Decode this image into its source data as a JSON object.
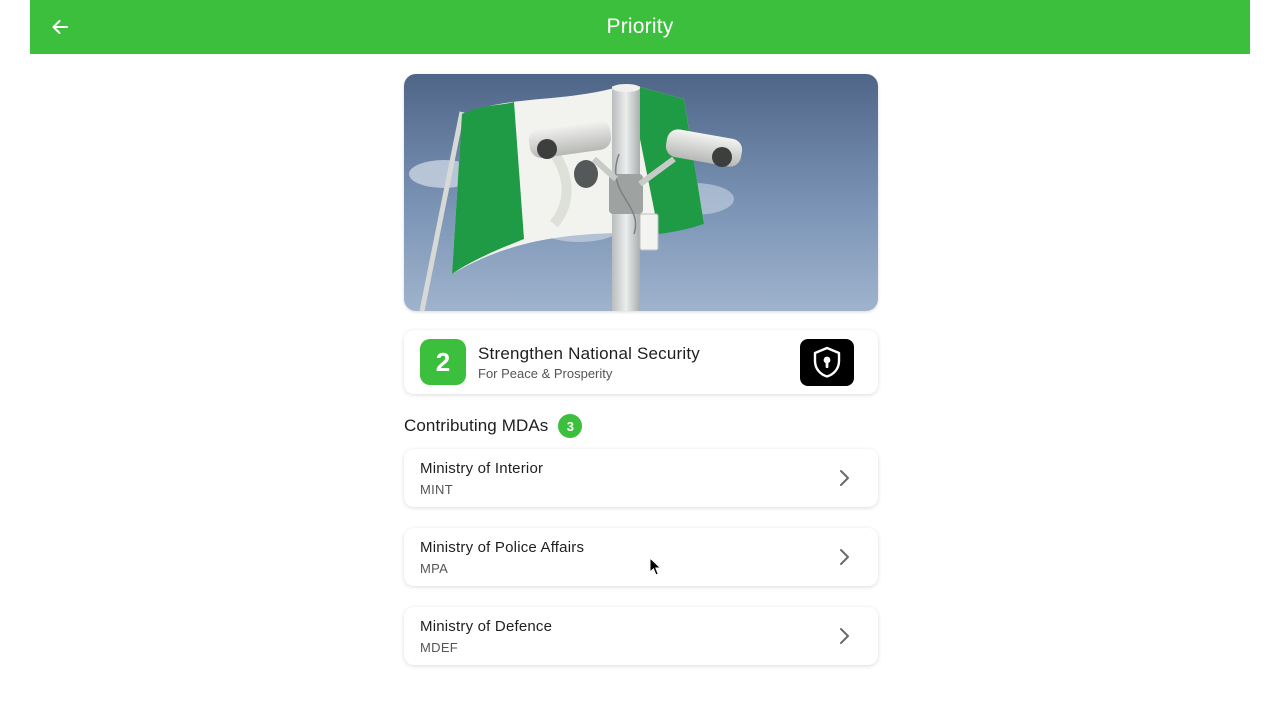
{
  "app_bar": {
    "title": "Priority",
    "back_icon": "arrow-left-icon",
    "color": "#3cbf3c"
  },
  "hero": {
    "image": "security-cameras-nigeria-flag-photo"
  },
  "priority": {
    "number": "2",
    "title": "Strengthen National Security",
    "subtitle": "For Peace & Prosperity",
    "icon": "shield-lock-icon"
  },
  "section": {
    "title": "Contributing MDAs",
    "count": "3"
  },
  "mdas": [
    {
      "name": "Ministry of Interior",
      "code": "MINT"
    },
    {
      "name": "Ministry of Police Affairs",
      "code": "MPA"
    },
    {
      "name": "Ministry of Defence",
      "code": "MDEF"
    }
  ]
}
